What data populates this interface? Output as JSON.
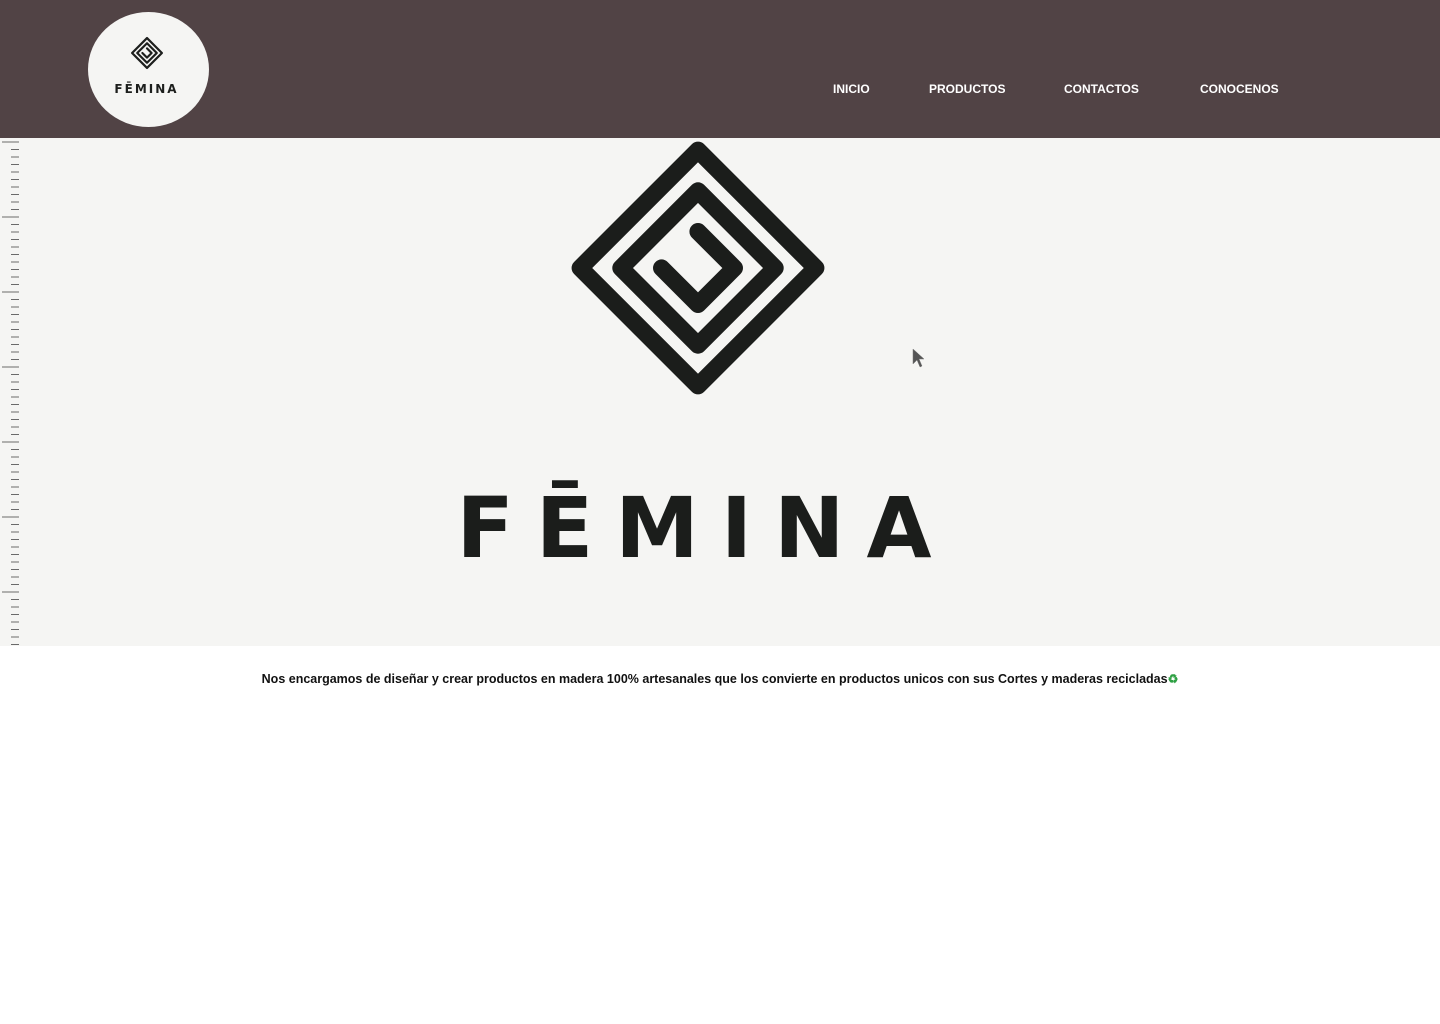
{
  "brand": {
    "name": "FĒMINA",
    "logo_icon": "femina-spiral-logo-icon",
    "header_bg": "#514345",
    "logo_bg": "#f5f5f3"
  },
  "nav": {
    "items": [
      {
        "label": "INICIO"
      },
      {
        "label": "PRODUCTOS"
      },
      {
        "label": "CONTACTOS"
      },
      {
        "label": "CONOCENOS"
      }
    ]
  },
  "hero": {
    "title": "FĒMINA",
    "bg": "#f5f5f3"
  },
  "about": {
    "tagline": "Nos encargamos de diseñar y crear productos en madera 100% artesanales que los convierte en productos  unicos con sus Cortes y maderas recicladas",
    "recycle_symbol": "♻",
    "recycle_color": "#2ea043"
  }
}
